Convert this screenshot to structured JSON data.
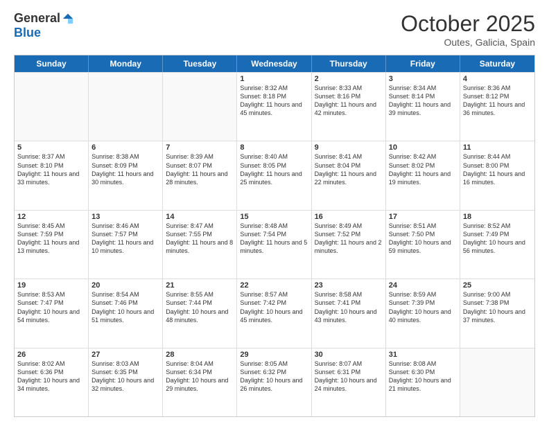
{
  "header": {
    "logo_general": "General",
    "logo_blue": "Blue",
    "month": "October 2025",
    "location": "Outes, Galicia, Spain"
  },
  "days_of_week": [
    "Sunday",
    "Monday",
    "Tuesday",
    "Wednesday",
    "Thursday",
    "Friday",
    "Saturday"
  ],
  "weeks": [
    [
      {
        "day": "",
        "empty": true
      },
      {
        "day": "",
        "empty": true
      },
      {
        "day": "",
        "empty": true
      },
      {
        "day": "1",
        "sunrise": "Sunrise: 8:32 AM",
        "sunset": "Sunset: 8:18 PM",
        "daylight": "Daylight: 11 hours and 45 minutes."
      },
      {
        "day": "2",
        "sunrise": "Sunrise: 8:33 AM",
        "sunset": "Sunset: 8:16 PM",
        "daylight": "Daylight: 11 hours and 42 minutes."
      },
      {
        "day": "3",
        "sunrise": "Sunrise: 8:34 AM",
        "sunset": "Sunset: 8:14 PM",
        "daylight": "Daylight: 11 hours and 39 minutes."
      },
      {
        "day": "4",
        "sunrise": "Sunrise: 8:36 AM",
        "sunset": "Sunset: 8:12 PM",
        "daylight": "Daylight: 11 hours and 36 minutes."
      }
    ],
    [
      {
        "day": "5",
        "sunrise": "Sunrise: 8:37 AM",
        "sunset": "Sunset: 8:10 PM",
        "daylight": "Daylight: 11 hours and 33 minutes."
      },
      {
        "day": "6",
        "sunrise": "Sunrise: 8:38 AM",
        "sunset": "Sunset: 8:09 PM",
        "daylight": "Daylight: 11 hours and 30 minutes."
      },
      {
        "day": "7",
        "sunrise": "Sunrise: 8:39 AM",
        "sunset": "Sunset: 8:07 PM",
        "daylight": "Daylight: 11 hours and 28 minutes."
      },
      {
        "day": "8",
        "sunrise": "Sunrise: 8:40 AM",
        "sunset": "Sunset: 8:05 PM",
        "daylight": "Daylight: 11 hours and 25 minutes."
      },
      {
        "day": "9",
        "sunrise": "Sunrise: 8:41 AM",
        "sunset": "Sunset: 8:04 PM",
        "daylight": "Daylight: 11 hours and 22 minutes."
      },
      {
        "day": "10",
        "sunrise": "Sunrise: 8:42 AM",
        "sunset": "Sunset: 8:02 PM",
        "daylight": "Daylight: 11 hours and 19 minutes."
      },
      {
        "day": "11",
        "sunrise": "Sunrise: 8:44 AM",
        "sunset": "Sunset: 8:00 PM",
        "daylight": "Daylight: 11 hours and 16 minutes."
      }
    ],
    [
      {
        "day": "12",
        "sunrise": "Sunrise: 8:45 AM",
        "sunset": "Sunset: 7:59 PM",
        "daylight": "Daylight: 11 hours and 13 minutes."
      },
      {
        "day": "13",
        "sunrise": "Sunrise: 8:46 AM",
        "sunset": "Sunset: 7:57 PM",
        "daylight": "Daylight: 11 hours and 10 minutes."
      },
      {
        "day": "14",
        "sunrise": "Sunrise: 8:47 AM",
        "sunset": "Sunset: 7:55 PM",
        "daylight": "Daylight: 11 hours and 8 minutes."
      },
      {
        "day": "15",
        "sunrise": "Sunrise: 8:48 AM",
        "sunset": "Sunset: 7:54 PM",
        "daylight": "Daylight: 11 hours and 5 minutes."
      },
      {
        "day": "16",
        "sunrise": "Sunrise: 8:49 AM",
        "sunset": "Sunset: 7:52 PM",
        "daylight": "Daylight: 11 hours and 2 minutes."
      },
      {
        "day": "17",
        "sunrise": "Sunrise: 8:51 AM",
        "sunset": "Sunset: 7:50 PM",
        "daylight": "Daylight: 10 hours and 59 minutes."
      },
      {
        "day": "18",
        "sunrise": "Sunrise: 8:52 AM",
        "sunset": "Sunset: 7:49 PM",
        "daylight": "Daylight: 10 hours and 56 minutes."
      }
    ],
    [
      {
        "day": "19",
        "sunrise": "Sunrise: 8:53 AM",
        "sunset": "Sunset: 7:47 PM",
        "daylight": "Daylight: 10 hours and 54 minutes."
      },
      {
        "day": "20",
        "sunrise": "Sunrise: 8:54 AM",
        "sunset": "Sunset: 7:46 PM",
        "daylight": "Daylight: 10 hours and 51 minutes."
      },
      {
        "day": "21",
        "sunrise": "Sunrise: 8:55 AM",
        "sunset": "Sunset: 7:44 PM",
        "daylight": "Daylight: 10 hours and 48 minutes."
      },
      {
        "day": "22",
        "sunrise": "Sunrise: 8:57 AM",
        "sunset": "Sunset: 7:42 PM",
        "daylight": "Daylight: 10 hours and 45 minutes."
      },
      {
        "day": "23",
        "sunrise": "Sunrise: 8:58 AM",
        "sunset": "Sunset: 7:41 PM",
        "daylight": "Daylight: 10 hours and 43 minutes."
      },
      {
        "day": "24",
        "sunrise": "Sunrise: 8:59 AM",
        "sunset": "Sunset: 7:39 PM",
        "daylight": "Daylight: 10 hours and 40 minutes."
      },
      {
        "day": "25",
        "sunrise": "Sunrise: 9:00 AM",
        "sunset": "Sunset: 7:38 PM",
        "daylight": "Daylight: 10 hours and 37 minutes."
      }
    ],
    [
      {
        "day": "26",
        "sunrise": "Sunrise: 8:02 AM",
        "sunset": "Sunset: 6:36 PM",
        "daylight": "Daylight: 10 hours and 34 minutes."
      },
      {
        "day": "27",
        "sunrise": "Sunrise: 8:03 AM",
        "sunset": "Sunset: 6:35 PM",
        "daylight": "Daylight: 10 hours and 32 minutes."
      },
      {
        "day": "28",
        "sunrise": "Sunrise: 8:04 AM",
        "sunset": "Sunset: 6:34 PM",
        "daylight": "Daylight: 10 hours and 29 minutes."
      },
      {
        "day": "29",
        "sunrise": "Sunrise: 8:05 AM",
        "sunset": "Sunset: 6:32 PM",
        "daylight": "Daylight: 10 hours and 26 minutes."
      },
      {
        "day": "30",
        "sunrise": "Sunrise: 8:07 AM",
        "sunset": "Sunset: 6:31 PM",
        "daylight": "Daylight: 10 hours and 24 minutes."
      },
      {
        "day": "31",
        "sunrise": "Sunrise: 8:08 AM",
        "sunset": "Sunset: 6:30 PM",
        "daylight": "Daylight: 10 hours and 21 minutes."
      },
      {
        "day": "",
        "empty": true
      }
    ]
  ]
}
